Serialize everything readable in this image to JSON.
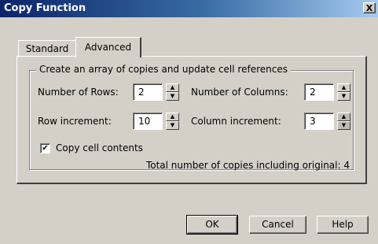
{
  "window": {
    "title": "Copy Function",
    "close_label": "X"
  },
  "tabs": [
    {
      "label": "Standard",
      "active": false
    },
    {
      "label": "Advanced",
      "active": true
    }
  ],
  "group": {
    "title": "Create an array of copies and update cell references",
    "rows_label": "Number of Rows:",
    "rows_value": "2",
    "columns_label": "Number of Columns:",
    "columns_value": "2",
    "row_increment_label": "Row increment:",
    "row_increment_value": "10",
    "column_increment_label": "Column increment:",
    "column_increment_value": "3",
    "copy_contents_label": "Copy cell contents",
    "copy_contents_checked": true,
    "total_text": "Total number of copies including original: 4"
  },
  "buttons": {
    "ok": "OK",
    "cancel": "Cancel",
    "help": "Help"
  },
  "glyphs": {
    "up": "▲",
    "down": "▼",
    "check": "✔"
  },
  "colors": {
    "face": "#d4d0c8",
    "title_start": "#0a246a",
    "title_end": "#a6caf0"
  }
}
